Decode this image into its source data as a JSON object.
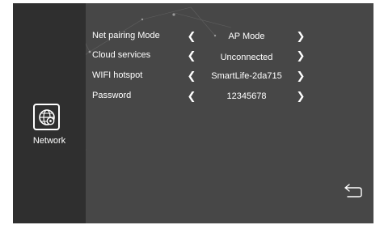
{
  "sidebar": {
    "network_label": "Network"
  },
  "settings": [
    {
      "label": "Net pairing Mode",
      "value": "AP Mode"
    },
    {
      "label": "Cloud services",
      "value": "Unconnected"
    },
    {
      "label": "WIFI hotspot",
      "value": "SmartLife-2da715"
    },
    {
      "label": "Password",
      "value": "12345678"
    }
  ],
  "icons": {
    "network": "globe-gear-icon",
    "previous": "chevron-left-icon",
    "next": "chevron-right-icon",
    "back": "return-arrow-icon"
  },
  "colors": {
    "panel_background": "#474747",
    "sidebar_background": "#2f2f2f",
    "text": "#ffffff"
  }
}
